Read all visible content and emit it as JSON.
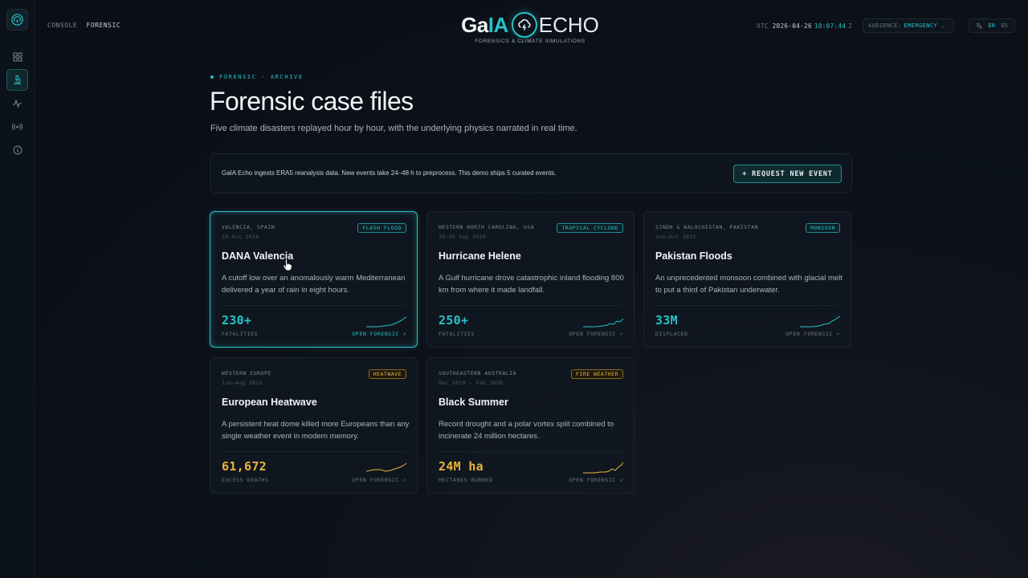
{
  "header": {
    "breadcrumb": [
      "CONSOLE",
      "FORENSIC"
    ],
    "brand": {
      "gai": "Ga",
      "ia": "IA",
      "echo": "ECHO",
      "tagline": "FORENSICS & CLIMATE SIMULATIONS"
    },
    "utc_label": "UTC",
    "utc_date": "2026-04-26",
    "utc_time": "10:07:44",
    "utc_suffix": "Z",
    "audience_label": "AUDIENCE:",
    "audience_value": "EMERGENCY",
    "languages": [
      "EN",
      "ES"
    ],
    "active_language": "EN"
  },
  "sidebar": {
    "items": [
      {
        "name": "dashboard",
        "icon": "grid-icon",
        "active": false
      },
      {
        "name": "forensic",
        "icon": "microscope-icon",
        "active": true
      },
      {
        "name": "signals",
        "icon": "activity-icon",
        "active": false
      },
      {
        "name": "broadcast",
        "icon": "radio-icon",
        "active": false
      },
      {
        "name": "info",
        "icon": "info-icon",
        "active": false
      }
    ]
  },
  "page": {
    "eyebrow": "FORENSIC · ARCHIVE",
    "title": "Forensic case files",
    "subtitle": "Five climate disasters replayed hour by hour, with the underlying physics narrated in real time."
  },
  "notice": {
    "text": "GaIA Echo ingests ERA5 reanalysis data. New events take 24–48 h to preprocess. This demo ships 5 curated events.",
    "button_label": "+ REQUEST NEW EVENT"
  },
  "open_label": "OPEN FORENSIC ↗",
  "colors": {
    "accent": "#27c2c9",
    "warm": "#e6b43a"
  },
  "cards": [
    {
      "location": "VALENCIA, SPAIN",
      "date": "29 Oct 2024",
      "tag": "FLASH FLOOD",
      "title": "DANA Valencia",
      "description": "A cutoff low over an anomalously warm Mediterranean delivered a year of rain in eight hours.",
      "stat": "230+",
      "stat_label": "FATALITIES",
      "tone": "cyan",
      "selected": true
    },
    {
      "location": "WESTERN NORTH CAROLINA, USA",
      "date": "25–30 Sep 2024",
      "tag": "TROPICAL CYCLONE",
      "title": "Hurricane Helene",
      "description": "A Gulf hurricane drove catastrophic inland flooding 800 km from where it made landfall.",
      "stat": "250+",
      "stat_label": "FATALITIES",
      "tone": "cyan",
      "selected": false
    },
    {
      "location": "SINDH & BALOCHISTAN, PAKISTAN",
      "date": "Jun–Oct 2022",
      "tag": "MONSOON",
      "title": "Pakistan Floods",
      "description": "An unprecedented monsoon combined with glacial melt to put a third of Pakistan underwater.",
      "stat": "33M",
      "stat_label": "DISPLACED",
      "tone": "cyan",
      "selected": false
    },
    {
      "location": "WESTERN EUROPE",
      "date": "Jun–Aug 2022",
      "tag": "HEATWAVE",
      "title": "European Heatwave",
      "description": "A persistent heat dome killed more Europeans than any single weather event in modern memory.",
      "stat": "61,672",
      "stat_label": "EXCESS DEATHS",
      "tone": "amber",
      "selected": false
    },
    {
      "location": "SOUTHEASTERN AUSTRALIA",
      "date": "Dec 2019 – Feb 2020",
      "tag": "FIRE WEATHER",
      "title": "Black Summer",
      "description": "Record drought and a polar vortex split combined to incinerate 24 million hectares.",
      "stat": "24M ha",
      "stat_label": "HECTARES BURNED",
      "tone": "amber",
      "selected": false
    }
  ]
}
